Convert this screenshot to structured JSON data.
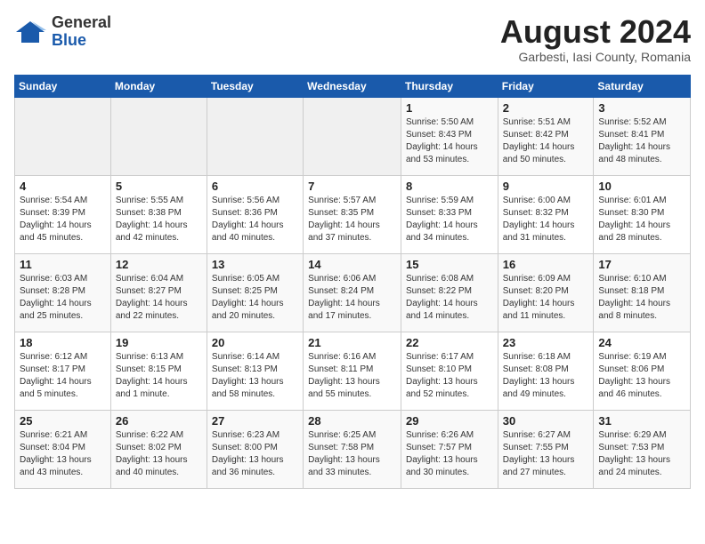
{
  "header": {
    "logo_general": "General",
    "logo_blue": "Blue",
    "title": "August 2024",
    "subtitle": "Garbesti, Iasi County, Romania"
  },
  "weekdays": [
    "Sunday",
    "Monday",
    "Tuesday",
    "Wednesday",
    "Thursday",
    "Friday",
    "Saturday"
  ],
  "weeks": [
    [
      {
        "day": "",
        "info": ""
      },
      {
        "day": "",
        "info": ""
      },
      {
        "day": "",
        "info": ""
      },
      {
        "day": "",
        "info": ""
      },
      {
        "day": "1",
        "info": "Sunrise: 5:50 AM\nSunset: 8:43 PM\nDaylight: 14 hours\nand 53 minutes."
      },
      {
        "day": "2",
        "info": "Sunrise: 5:51 AM\nSunset: 8:42 PM\nDaylight: 14 hours\nand 50 minutes."
      },
      {
        "day": "3",
        "info": "Sunrise: 5:52 AM\nSunset: 8:41 PM\nDaylight: 14 hours\nand 48 minutes."
      }
    ],
    [
      {
        "day": "4",
        "info": "Sunrise: 5:54 AM\nSunset: 8:39 PM\nDaylight: 14 hours\nand 45 minutes."
      },
      {
        "day": "5",
        "info": "Sunrise: 5:55 AM\nSunset: 8:38 PM\nDaylight: 14 hours\nand 42 minutes."
      },
      {
        "day": "6",
        "info": "Sunrise: 5:56 AM\nSunset: 8:36 PM\nDaylight: 14 hours\nand 40 minutes."
      },
      {
        "day": "7",
        "info": "Sunrise: 5:57 AM\nSunset: 8:35 PM\nDaylight: 14 hours\nand 37 minutes."
      },
      {
        "day": "8",
        "info": "Sunrise: 5:59 AM\nSunset: 8:33 PM\nDaylight: 14 hours\nand 34 minutes."
      },
      {
        "day": "9",
        "info": "Sunrise: 6:00 AM\nSunset: 8:32 PM\nDaylight: 14 hours\nand 31 minutes."
      },
      {
        "day": "10",
        "info": "Sunrise: 6:01 AM\nSunset: 8:30 PM\nDaylight: 14 hours\nand 28 minutes."
      }
    ],
    [
      {
        "day": "11",
        "info": "Sunrise: 6:03 AM\nSunset: 8:28 PM\nDaylight: 14 hours\nand 25 minutes."
      },
      {
        "day": "12",
        "info": "Sunrise: 6:04 AM\nSunset: 8:27 PM\nDaylight: 14 hours\nand 22 minutes."
      },
      {
        "day": "13",
        "info": "Sunrise: 6:05 AM\nSunset: 8:25 PM\nDaylight: 14 hours\nand 20 minutes."
      },
      {
        "day": "14",
        "info": "Sunrise: 6:06 AM\nSunset: 8:24 PM\nDaylight: 14 hours\nand 17 minutes."
      },
      {
        "day": "15",
        "info": "Sunrise: 6:08 AM\nSunset: 8:22 PM\nDaylight: 14 hours\nand 14 minutes."
      },
      {
        "day": "16",
        "info": "Sunrise: 6:09 AM\nSunset: 8:20 PM\nDaylight: 14 hours\nand 11 minutes."
      },
      {
        "day": "17",
        "info": "Sunrise: 6:10 AM\nSunset: 8:18 PM\nDaylight: 14 hours\nand 8 minutes."
      }
    ],
    [
      {
        "day": "18",
        "info": "Sunrise: 6:12 AM\nSunset: 8:17 PM\nDaylight: 14 hours\nand 5 minutes."
      },
      {
        "day": "19",
        "info": "Sunrise: 6:13 AM\nSunset: 8:15 PM\nDaylight: 14 hours\nand 1 minute."
      },
      {
        "day": "20",
        "info": "Sunrise: 6:14 AM\nSunset: 8:13 PM\nDaylight: 13 hours\nand 58 minutes."
      },
      {
        "day": "21",
        "info": "Sunrise: 6:16 AM\nSunset: 8:11 PM\nDaylight: 13 hours\nand 55 minutes."
      },
      {
        "day": "22",
        "info": "Sunrise: 6:17 AM\nSunset: 8:10 PM\nDaylight: 13 hours\nand 52 minutes."
      },
      {
        "day": "23",
        "info": "Sunrise: 6:18 AM\nSunset: 8:08 PM\nDaylight: 13 hours\nand 49 minutes."
      },
      {
        "day": "24",
        "info": "Sunrise: 6:19 AM\nSunset: 8:06 PM\nDaylight: 13 hours\nand 46 minutes."
      }
    ],
    [
      {
        "day": "25",
        "info": "Sunrise: 6:21 AM\nSunset: 8:04 PM\nDaylight: 13 hours\nand 43 minutes."
      },
      {
        "day": "26",
        "info": "Sunrise: 6:22 AM\nSunset: 8:02 PM\nDaylight: 13 hours\nand 40 minutes."
      },
      {
        "day": "27",
        "info": "Sunrise: 6:23 AM\nSunset: 8:00 PM\nDaylight: 13 hours\nand 36 minutes."
      },
      {
        "day": "28",
        "info": "Sunrise: 6:25 AM\nSunset: 7:58 PM\nDaylight: 13 hours\nand 33 minutes."
      },
      {
        "day": "29",
        "info": "Sunrise: 6:26 AM\nSunset: 7:57 PM\nDaylight: 13 hours\nand 30 minutes."
      },
      {
        "day": "30",
        "info": "Sunrise: 6:27 AM\nSunset: 7:55 PM\nDaylight: 13 hours\nand 27 minutes."
      },
      {
        "day": "31",
        "info": "Sunrise: 6:29 AM\nSunset: 7:53 PM\nDaylight: 13 hours\nand 24 minutes."
      }
    ]
  ]
}
